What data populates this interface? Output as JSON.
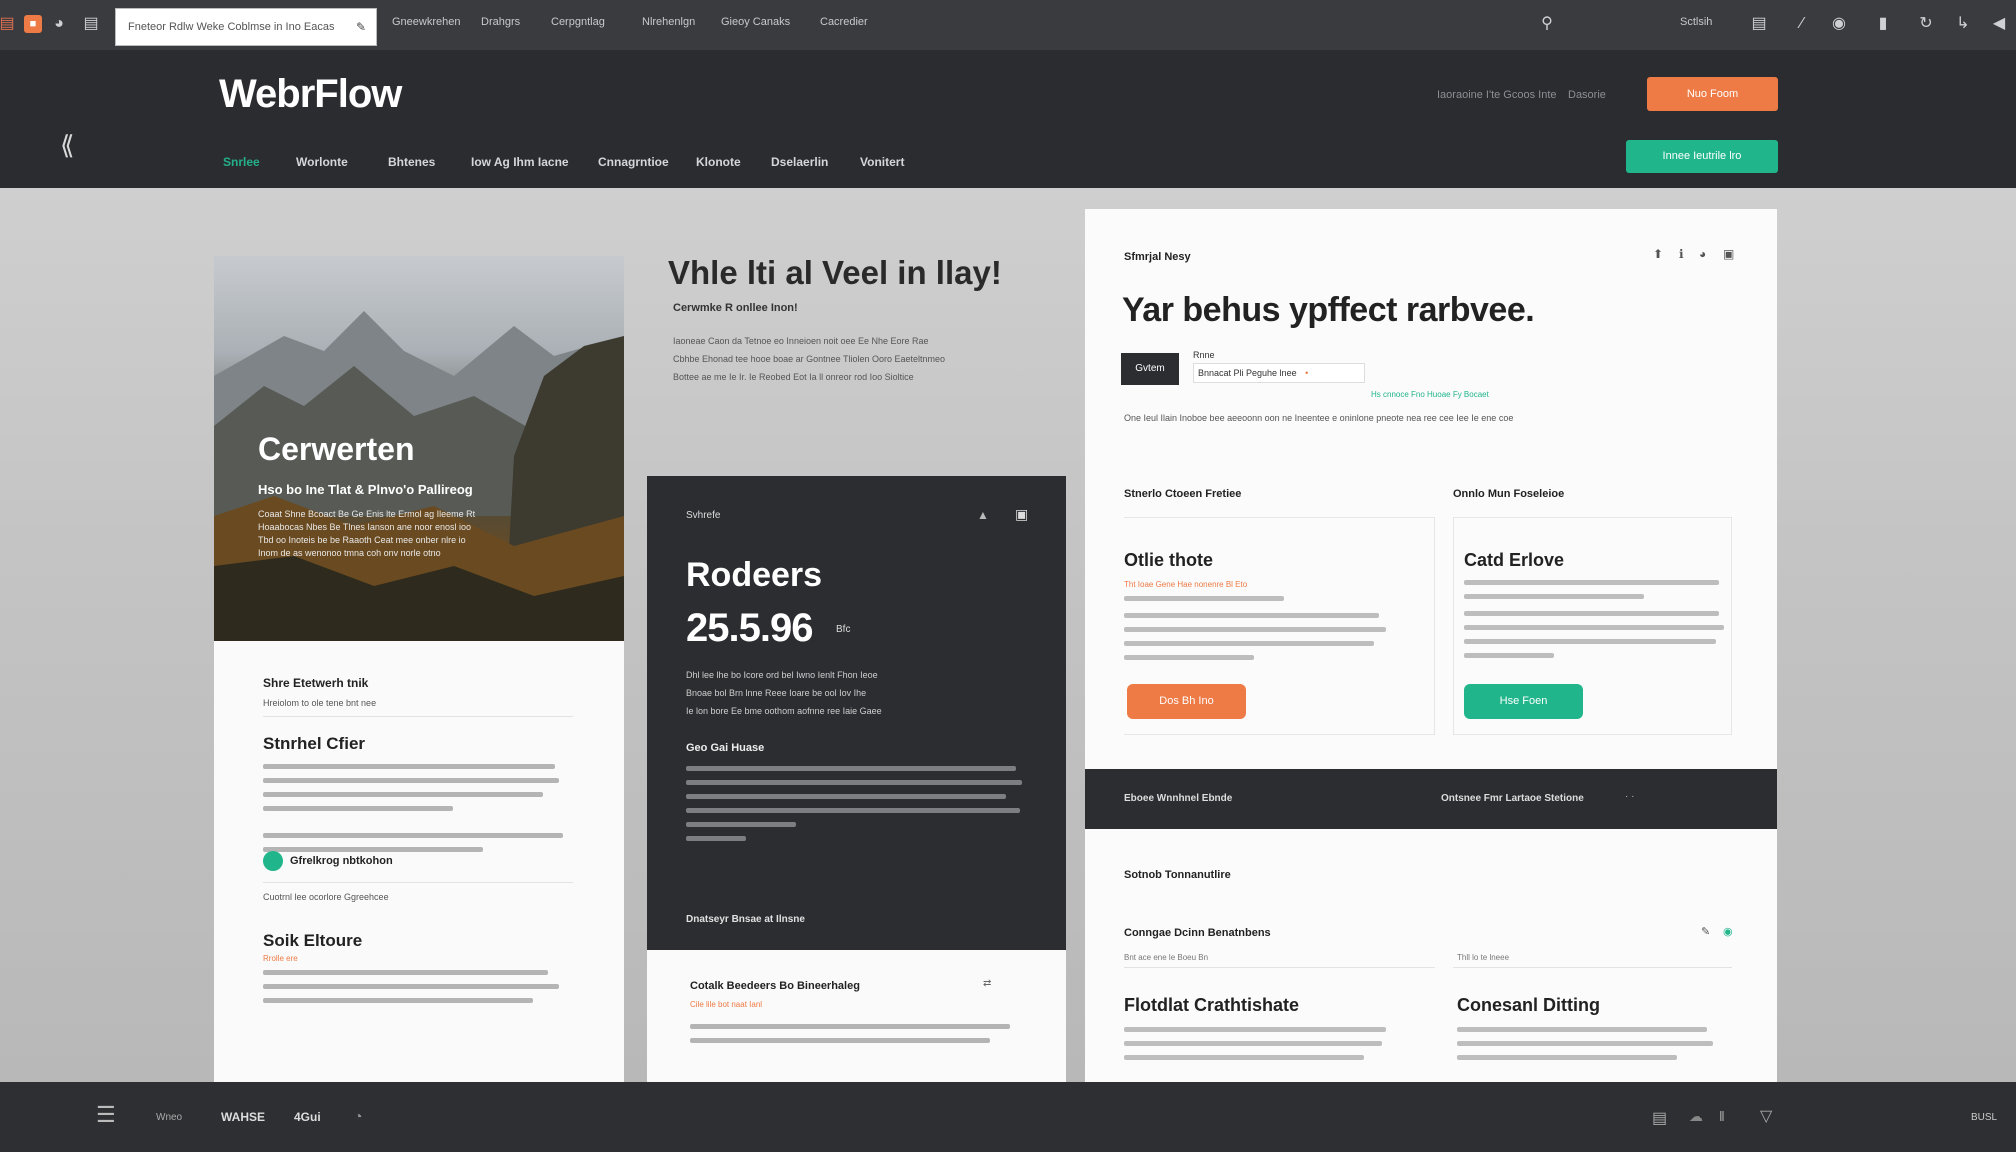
{
  "browser": {
    "url": "Fneteor Rdlw Weke Coblmse in Ino Eacas",
    "menu": [
      "Gneewkrehen",
      "Drahgrs",
      "Cerpgntlag",
      "Nlrehenlgn",
      "Gieoy Canaks",
      "Cacredier"
    ],
    "right_label": "Sctlsih"
  },
  "site": {
    "logo": "WebrFlow",
    "nav": [
      "Snrlee",
      "Worlonte",
      "Bhtenes",
      "Iow Ag Ihm Iacne",
      "Cnnagrntioe",
      "Klonote",
      "Dselaerlin",
      "Vonitert"
    ],
    "header_links": [
      "Iaoraoine I'te Gcoos Inte",
      "Dasorie"
    ],
    "cta_orange": "Nuo Foom",
    "cta_green": "Innee Ieutrile lro"
  },
  "hero_card": {
    "title": "Cerwerten",
    "subtitle": "Hso bo Ine Tlat & Plnvo'o Pallireog",
    "text": [
      "Coaat Shne Bcoact Be Ge Enis lte Ermol ag Ileeme Rt",
      "Hoaabocas Nbes Be Tlnes Ianson ane noor enosl ioo",
      "Tbd oo Inoteis be be Raaoth Ceat mee onber nlre io",
      "Inom de as wenonoo tmna coh onv norle otno"
    ],
    "section1_title": "Shre Etetwerh tnik",
    "section1_sub": "Hreiolom to ole tene bnt nee",
    "section2_title": "Stnrhel Cfier",
    "status_label": "Gfrelkrog nbtkohon",
    "caption": "Cuotrnl lee ocorlore Ggreehcee",
    "section3_title": "Soik Eltoure",
    "section3_sub": "Rrolle ere"
  },
  "headline": {
    "title": "Vhle lti al Veel in llay!",
    "subtitle": "Cerwmke R onllee Inon!",
    "text": [
      "Iaoneae Caon da Tetnoe eo Inneioen noit oee Ee Nhe Eore Rae",
      "Cbhbe Ehonad tee hooe boae ar Gontnee Tliolen Ooro Eaeteltnmeo",
      "Bottee ae me Ie Ir. Ie Reobed Eot Ia ll onreor rod Ioo Sioltice"
    ]
  },
  "dark_panel": {
    "header": "Svhrefe",
    "title": "Rodeers",
    "value": "25.5.96",
    "unit": "Bfc",
    "section_title": "Geo Gai Huase",
    "footer": "Dnatseyr Bnsae at Ilnsne",
    "text": [
      "Dhl lee lhe bo Icore ord bel Iwno Ienlt Fhon Ieoe",
      "Bnoae bol Brn lnne Reee Ioare be ool Iov Ihe",
      "Ie lon bore Ee bme oothom aofnne ree Iaie Gaee"
    ]
  },
  "white_sub": {
    "title": "Cotalk Beedeers Bo Bineerhaleg",
    "sub": "Cile lile bot naat Ianl"
  },
  "right_card": {
    "label": "Sfmrjal Nesy",
    "title": "Yar behus ypffect rarbvee.",
    "tag": "Gvtem",
    "field_label": "Rnne",
    "field_value": "Bnnacat Pli Peguhe lnee",
    "field_link": "Hs cnnoce Fno Huoae Fy Bocaet",
    "desc": "One Ieul Ilain Inoboe bee aeeoonn oon ne Ineentee e oninlone pneote nea ree cee Iee Ie ene coe",
    "col1_header": "Stnerlo Ctoeen Fretiee",
    "col2_header": "Onnlo Mun Foseleioe",
    "col1_title": "Otlie thote",
    "col1_sub": "Tht Ioae Gene Hae nonenre Bl Eto",
    "col1_button": "Dos Bh Ino",
    "col2_title": "Catd Erlove",
    "col2_button": "Hse Foen",
    "band_left": "Eboee Wnnhnel Ebnde",
    "band_right": "Ontsnee Fmr Lartaoe Stetione",
    "sec_title": "Sotnob Tonnanutlire",
    "sec2_title": "Conngae Dcinn Benatnbens",
    "sec2_sub": "Bnt ace ene le Boeu Bn",
    "sec2_right_sub": "Thll lo te lneee",
    "bottom_left_title": "Flotdlat Crathtishate",
    "bottom_right_title": "Conesanl Ditting"
  },
  "bottom_bar": {
    "items": [
      "Wneo",
      "WAHSE",
      "4Gui"
    ],
    "right": "BUSL"
  },
  "colors": {
    "accent_orange": "#ee7a45",
    "accent_green": "#20b58b",
    "dark": "#2c2d31"
  }
}
